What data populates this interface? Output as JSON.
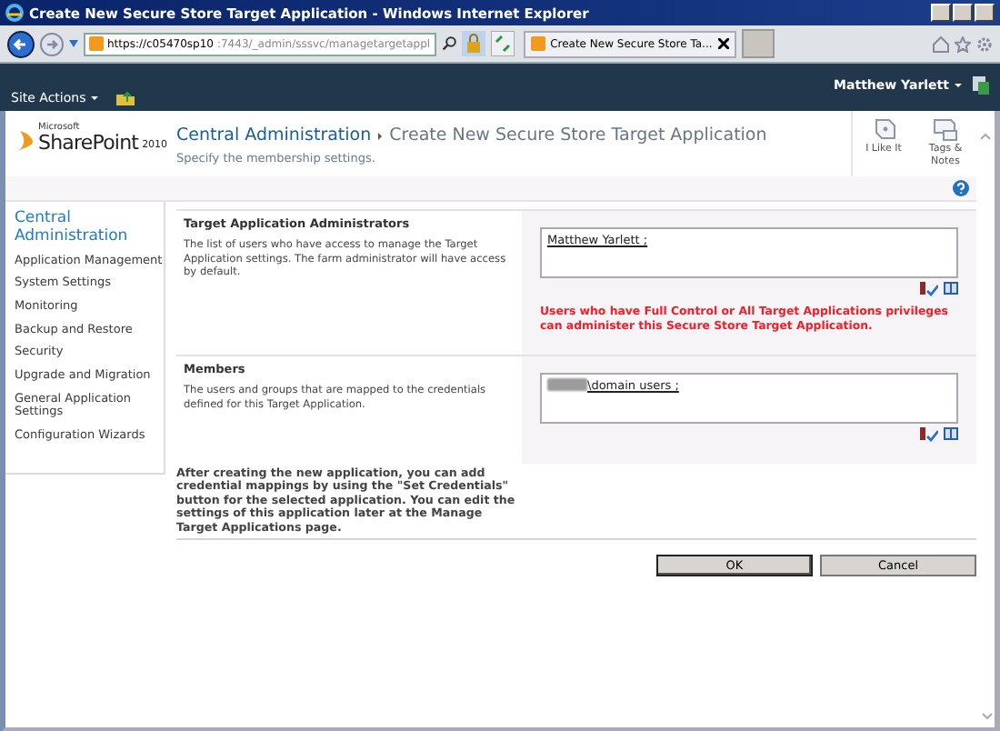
{
  "window": {
    "title": "Create New Secure Store Target Application - Windows Internet Explorer"
  },
  "address_bar": {
    "url_host": "https://c05470sp10",
    "url_path": ":7443/_admin/sssvc/managetargetappl"
  },
  "browser_tab": {
    "title": "Create New Secure Store Ta..."
  },
  "ribbon": {
    "site_actions": "Site Actions",
    "user": "Matthew Yarlett"
  },
  "header": {
    "logo_small": "Microsoft",
    "logo": "SharePoint",
    "logo_year": "2010",
    "breadcrumb": [
      "Central Administration",
      "Create New Secure Store Target Application"
    ],
    "description": "Specify the membership settings.",
    "actions": [
      {
        "kind": "like",
        "label": "I Like It"
      },
      {
        "kind": "tags",
        "label": "Tags & Notes"
      }
    ]
  },
  "nav": {
    "heading": "Central Administration",
    "items": [
      "Application Management",
      "System Settings",
      "Monitoring",
      "Backup and Restore",
      "Security",
      "Upgrade and Migration",
      "General Application Settings",
      "Configuration Wizards"
    ]
  },
  "sections": [
    {
      "title": "Target Application Administrators",
      "description": "The list of users who have access to manage the Target Application settings. The farm administrator will have access by default.",
      "value": "Matthew Yarlett ;",
      "redacted_prefix": false,
      "warning": "Users who have Full Control or All Target Applications privileges can administer this Secure Store Target Application."
    },
    {
      "title": "Members",
      "description": "The users and groups that are mapped to the credentials defined for this Target Application.",
      "value": "\\domain users ;",
      "redacted_prefix": true
    }
  ],
  "footer_note": "After creating the new application, you can add credential mappings by using the \"Set Credentials\" button for the selected application. You can edit the settings of this application later at the Manage Target Applications page.",
  "buttons": [
    "OK",
    "Cancel"
  ]
}
